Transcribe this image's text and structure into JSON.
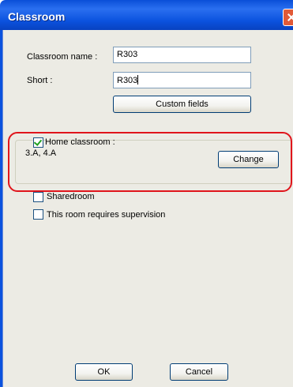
{
  "window": {
    "title": "Classroom"
  },
  "form": {
    "name_label": "Classroom name :",
    "name_value": "R303",
    "short_label": "Short :",
    "short_value": "R303",
    "custom_fields_label": "Custom fields"
  },
  "home": {
    "checkbox_label": "Home classroom :",
    "checked": true,
    "classes": "3.A, 4.A",
    "change_label": "Change"
  },
  "options": {
    "shared_label": "Sharedroom",
    "shared_checked": false,
    "supervision_label": "This room requires supervision",
    "supervision_checked": false
  },
  "footer": {
    "ok_label": "OK",
    "cancel_label": "Cancel"
  },
  "colors": {
    "titlebar": "#0b52de",
    "highlight": "#e0141b",
    "dialog_bg": "#ecebe4"
  }
}
